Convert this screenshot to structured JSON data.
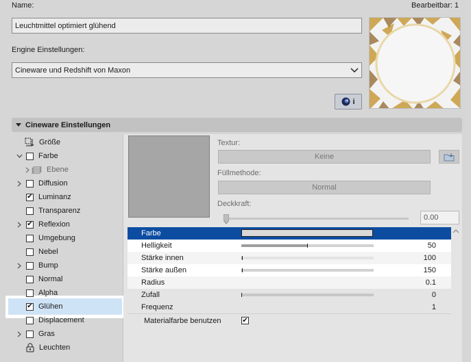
{
  "header": {
    "name_label": "Name:",
    "edit_label": "Bearbeitbar: 1",
    "name_value": "Leuchtmittel optimiert glühend",
    "engine_label": "Engine Einstellungen:",
    "engine_value": "Cineware und Redshift von Maxon",
    "info_button_label": "i"
  },
  "section": {
    "title": "Cineware Einstellungen"
  },
  "tree": {
    "items": [
      {
        "label": "Größe",
        "chevron": "",
        "check": "none",
        "icon": "resize-icon"
      },
      {
        "label": "Farbe",
        "chevron": "down",
        "check": "off",
        "icon": ""
      },
      {
        "label": "Ebene",
        "chevron": "right",
        "check": "none",
        "icon": "layers-icon"
      },
      {
        "label": "Diffusion",
        "chevron": "right",
        "check": "off",
        "icon": ""
      },
      {
        "label": "Luminanz",
        "chevron": "",
        "check": "on",
        "icon": ""
      },
      {
        "label": "Transparenz",
        "chevron": "",
        "check": "off",
        "icon": ""
      },
      {
        "label": "Reflexion",
        "chevron": "right",
        "check": "on",
        "icon": ""
      },
      {
        "label": "Umgebung",
        "chevron": "",
        "check": "off",
        "icon": ""
      },
      {
        "label": "Nebel",
        "chevron": "",
        "check": "off",
        "icon": ""
      },
      {
        "label": "Bump",
        "chevron": "right",
        "check": "off",
        "icon": ""
      },
      {
        "label": "Normal",
        "chevron": "",
        "check": "off",
        "icon": ""
      },
      {
        "label": "Alpha",
        "chevron": "",
        "check": "off",
        "icon": ""
      },
      {
        "label": "Glühen",
        "chevron": "",
        "check": "on",
        "icon": ""
      },
      {
        "label": "Displacement",
        "chevron": "",
        "check": "off",
        "icon": ""
      },
      {
        "label": "Gras",
        "chevron": "right",
        "check": "off",
        "icon": ""
      },
      {
        "label": "Leuchten",
        "chevron": "",
        "check": "none",
        "icon": "lock-icon"
      }
    ]
  },
  "texture": {
    "label": "Textur:",
    "value": "Keine",
    "fill_label": "Füllmethode:",
    "fill_value": "Normal",
    "opacity_label": "Deckkraft:",
    "opacity_value": "0.00"
  },
  "props": [
    {
      "name": "Farbe",
      "value": "",
      "level": null
    },
    {
      "name": "Helligkeit",
      "value": "50",
      "level": 0.5
    },
    {
      "name": "Stärke innen",
      "value": "100",
      "level": 0.01
    },
    {
      "name": "Stärke außen",
      "value": "150",
      "level": 0.01
    },
    {
      "name": "Radius",
      "value": "0.1",
      "level": null
    },
    {
      "name": "Zufall",
      "value": "0",
      "level": 0.0
    },
    {
      "name": "Frequenz",
      "value": "1",
      "level": null
    }
  ],
  "material_color": {
    "label": "Materialfarbe benutzen",
    "checked": true
  },
  "colors": {
    "selection": "#0c4da2",
    "highlight": "#cfe3f7",
    "gold": "#c89b3c"
  }
}
